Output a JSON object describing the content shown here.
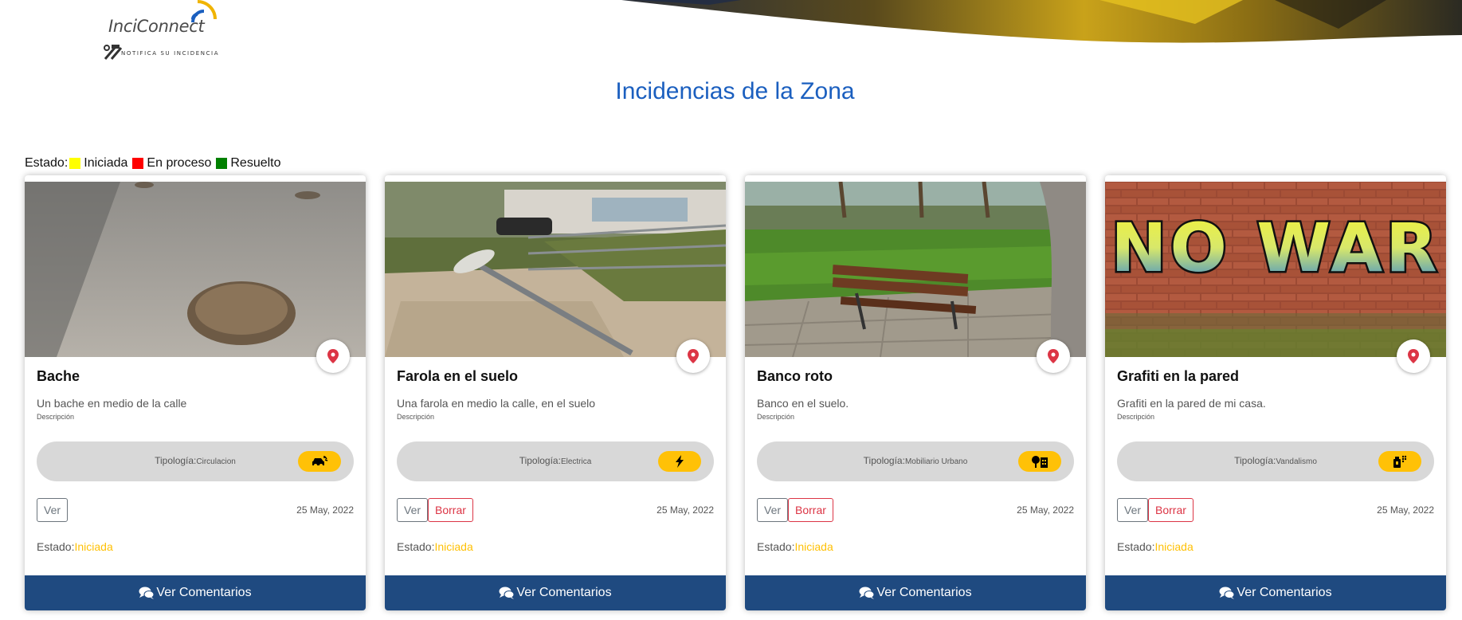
{
  "brand": {
    "name": "InciConnect",
    "tagline": "NOTIFICA SU INCIDENCIA"
  },
  "page": {
    "title": "Incidencias de la Zona"
  },
  "legend": {
    "label": "Estado:",
    "items": [
      {
        "label": "Iniciada",
        "color": "#ffff00"
      },
      {
        "label": "En proceso",
        "color": "#ff0000"
      },
      {
        "label": "Resuelto",
        "color": "#008000"
      }
    ]
  },
  "labels": {
    "description": "Descripción",
    "tipologia": "Tipología:",
    "ver": "Ver",
    "borrar": "Borrar",
    "estado": "Estado:",
    "comments": "Ver Comentarios"
  },
  "colors": {
    "title_blue": "#1b5fbf",
    "comments_bar": "#1f4a80",
    "status_iniciada": "#ffc107",
    "type_badge": "#ffc107",
    "map_pin": "#dc3545"
  },
  "cards": [
    {
      "title": "Bache",
      "description": "Un bache en medio de la calle",
      "tipologia": "Circulacion",
      "type_icon": "car-crash-icon",
      "date": "25 May, 2022",
      "estado": "Iniciada",
      "image": "pothole-photo"
    },
    {
      "title": "Farola en el suelo",
      "description": "Una farola en medio la calle, en el suelo",
      "tipologia": "Electrica",
      "type_icon": "lightning-bolt-icon",
      "date": "25 May, 2022",
      "estado": "Iniciada",
      "image": "fallen-streetlight-photo"
    },
    {
      "title": "Banco roto",
      "description": "Banco en el suelo.",
      "tipologia": "Mobiliario Urbano",
      "type_icon": "tree-and-building-icon",
      "date": "25 May, 2022",
      "estado": "Iniciada",
      "image": "broken-bench-photo"
    },
    {
      "title": "Grafiti en la pared",
      "description": "Grafiti en la pared de mi casa.",
      "tipologia": "Vandalismo",
      "type_icon": "spray-can-icon",
      "date": "25 May, 2022",
      "estado": "Iniciada",
      "image": "graffiti-wall-photo",
      "image_text": "NO WAR"
    }
  ]
}
